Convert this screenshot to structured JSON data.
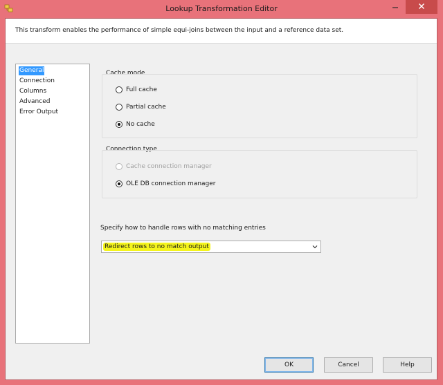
{
  "window": {
    "title": "Lookup Transformation Editor",
    "icons": {
      "app": "ssis-component-icon",
      "minimize": "minimize-icon",
      "close": "close-icon"
    }
  },
  "description": "This transform enables the performance of simple equi-joins between the input and a reference data set.",
  "nav": {
    "selected": "General",
    "items": [
      "General",
      "Connection",
      "Columns",
      "Advanced",
      "Error Output"
    ]
  },
  "cache_mode": {
    "label": "Cache mode",
    "options": [
      {
        "label": "Full cache",
        "checked": false,
        "enabled": true
      },
      {
        "label": "Partial cache",
        "checked": false,
        "enabled": true
      },
      {
        "label": "No cache",
        "checked": true,
        "enabled": true
      }
    ]
  },
  "connection_type": {
    "label": "Connection type",
    "options": [
      {
        "label": "Cache connection manager",
        "checked": false,
        "enabled": false
      },
      {
        "label": "OLE DB connection manager",
        "checked": true,
        "enabled": true
      }
    ]
  },
  "no_match": {
    "label": "Specify how to handle rows with no matching entries",
    "selected": "Redirect rows to no match output"
  },
  "buttons": {
    "ok": "OK",
    "cancel": "Cancel",
    "help": "Help"
  },
  "colors": {
    "frame": "#e8727a",
    "selection": "#3399ff",
    "highlight": "#f4f41c"
  }
}
